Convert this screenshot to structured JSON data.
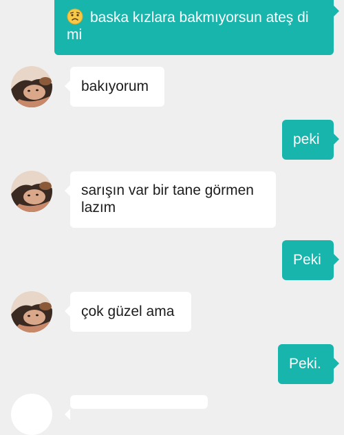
{
  "conversation": {
    "messages": [
      {
        "direction": "out",
        "emoji": "worried-face-emoji",
        "text": "baska kızlara bakmıyorsun ateş di mi"
      },
      {
        "direction": "in",
        "text": "bakıyorum"
      },
      {
        "direction": "out",
        "text": "peki"
      },
      {
        "direction": "in",
        "text": "sarışın var bir tane görmen lazım"
      },
      {
        "direction": "out",
        "text": "Peki"
      },
      {
        "direction": "in",
        "text": "çok güzel ama"
      },
      {
        "direction": "out",
        "text": "Peki."
      }
    ]
  },
  "colors": {
    "background": "#efefef",
    "outgoing_bubble": "#18b5ad",
    "incoming_bubble": "#ffffff"
  }
}
